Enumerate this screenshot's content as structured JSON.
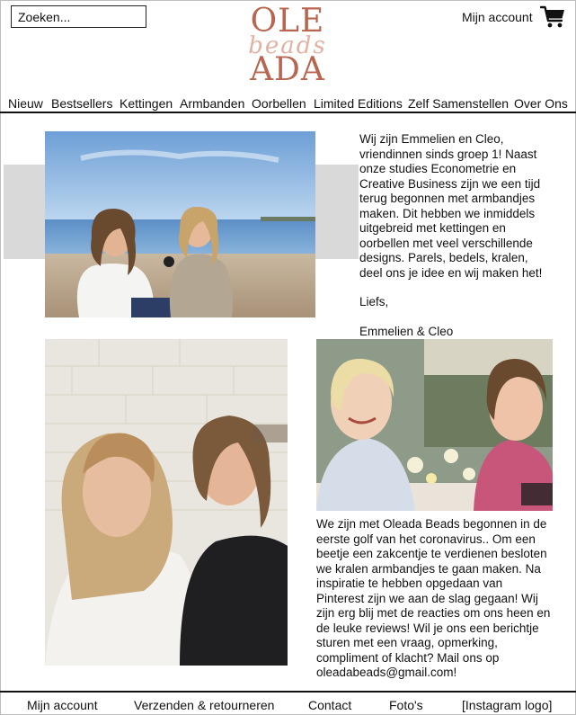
{
  "header": {
    "search_placeholder": "Zoeken...",
    "logo": {
      "top": "OLE",
      "script": "beads",
      "bottom": "ADA",
      "color": "#b8664f"
    },
    "account_label": "Mijn account",
    "cart_icon": "shopping-cart-icon"
  },
  "nav": {
    "items": [
      "Nieuw",
      "Bestsellers",
      "Kettingen",
      "Armbanden",
      "Oorbellen",
      "Limited Editions",
      "Zelf Samenstellen",
      "Over Ons"
    ]
  },
  "about": {
    "intro": "Wij zijn Emmelien en Cleo, vriendinnen sinds groep 1! Naast onze studies Econometrie en Creative Business zijn we een tijd terug begonnen met armbandjes maken. Dit hebben we inmiddels uitgebreid met kettingen en oorbellen met veel verschillende designs. Parels, bedels, kralen, deel ons je idee en wij maken het!",
    "greeting": "Liefs,",
    "signature": "Emmelien & Cleo",
    "story": "We zijn met Oleada Beads begonnen in de eerste golf van het coronavirus.. Om een beetje een zakcentje te verdienen besloten we kralen armbandjes te gaan maken. Na inspiratie te hebben opgedaan van Pinterest zijn we aan de slag gegaan! Wij zijn erg blij met de reacties om ons heen en de leuke reviews! Wil je ons een berichtje sturen met een vraag, opmerking, compliment of klacht? Mail ons op oleadabeads@gmail.com!"
  },
  "footer": {
    "items": [
      "Mijn account",
      "Verzenden & retourneren",
      "Contact",
      "Foto's",
      "[Instagram logo]"
    ]
  }
}
